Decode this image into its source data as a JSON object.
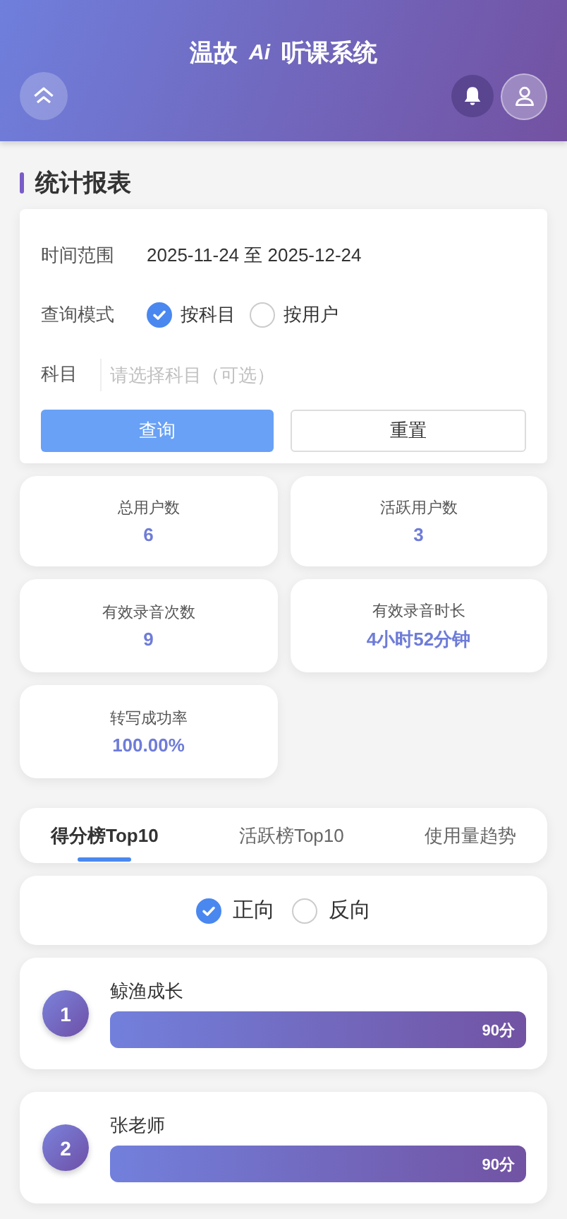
{
  "header": {
    "title_parts": [
      "温故",
      "Ai",
      "听课系统"
    ]
  },
  "section_title": "统计报表",
  "filters": {
    "date_label": "时间范围",
    "date_value": "2025-11-24 至 2025-12-24",
    "mode_label": "查询模式",
    "modes": [
      {
        "label": "按科目",
        "selected": true
      },
      {
        "label": "按用户",
        "selected": false
      }
    ],
    "subject_label": "科目",
    "subject_placeholder": "请选择科目（可选）",
    "query_button": "查询",
    "reset_button": "重置"
  },
  "stats": [
    {
      "label": "总用户数",
      "value": "6"
    },
    {
      "label": "活跃用户数",
      "value": "3"
    },
    {
      "label": "有效录音次数",
      "value": "9"
    },
    {
      "label": "有效录音时长",
      "value": "4小时52分钟"
    },
    {
      "label": "转写成功率",
      "value": "100.00%"
    }
  ],
  "tabs": [
    {
      "label": "得分榜Top10",
      "selected": true
    },
    {
      "label": "活跃榜Top10",
      "selected": false
    },
    {
      "label": "使用量趋势",
      "selected": false
    }
  ],
  "directions": [
    {
      "label": "正向",
      "selected": true
    },
    {
      "label": "反向",
      "selected": false
    }
  ],
  "ranking": [
    {
      "rank": "1",
      "name": "鲸渔成长",
      "score": "90分",
      "level": 1
    },
    {
      "rank": "2",
      "name": "张老师",
      "score": "90分",
      "level": 1
    }
  ]
}
